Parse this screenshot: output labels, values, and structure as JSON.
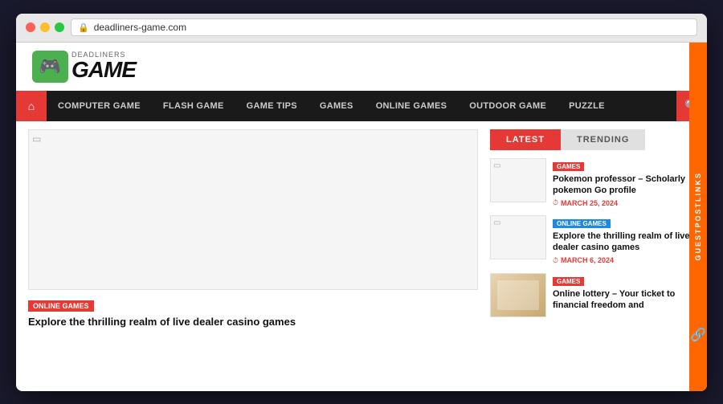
{
  "browser": {
    "traffic_lights": [
      "red",
      "yellow",
      "green"
    ],
    "url": "deadliners-game.com",
    "lock_icon": "🔒"
  },
  "header": {
    "logo": {
      "icon": "🎮",
      "deadliners_label": "DEADLINERS",
      "game_label": "GAME"
    }
  },
  "nav": {
    "home_icon": "⌂",
    "search_icon": "🔍",
    "items": [
      {
        "label": "COMPUTER GAME"
      },
      {
        "label": "FLASH GAME"
      },
      {
        "label": "GAME TIPS"
      },
      {
        "label": "GAMES"
      },
      {
        "label": "ONLINE GAMES"
      },
      {
        "label": "OUTDOOR GAME"
      },
      {
        "label": "PUZZLE"
      }
    ]
  },
  "sidebar": {
    "tab_latest": "LATEST",
    "tab_trending": "TRENDING",
    "articles": [
      {
        "tag": "GAMES",
        "tag_color": "red",
        "title": "Pokemon professor – Scholarly pokemon Go profile",
        "date": "MARCH 25, 2024",
        "has_image": false
      },
      {
        "tag": "ONLINE GAMES",
        "tag_color": "blue",
        "title": "Explore the thrilling realm of live dealer casino games",
        "date": "MARCH 6, 2024",
        "has_image": false
      },
      {
        "tag": "GAMES",
        "tag_color": "red",
        "title": "Online lottery – Your ticket to financial freedom and",
        "date": "",
        "has_image": true
      }
    ]
  },
  "main": {
    "bottom_article": {
      "tag": "ONLINE GAMES",
      "title": "Explore the thrilling realm of live dealer casino games"
    }
  },
  "side_banner": {
    "text": "GUESTPOSTLINKS",
    "icon": "🔗"
  }
}
